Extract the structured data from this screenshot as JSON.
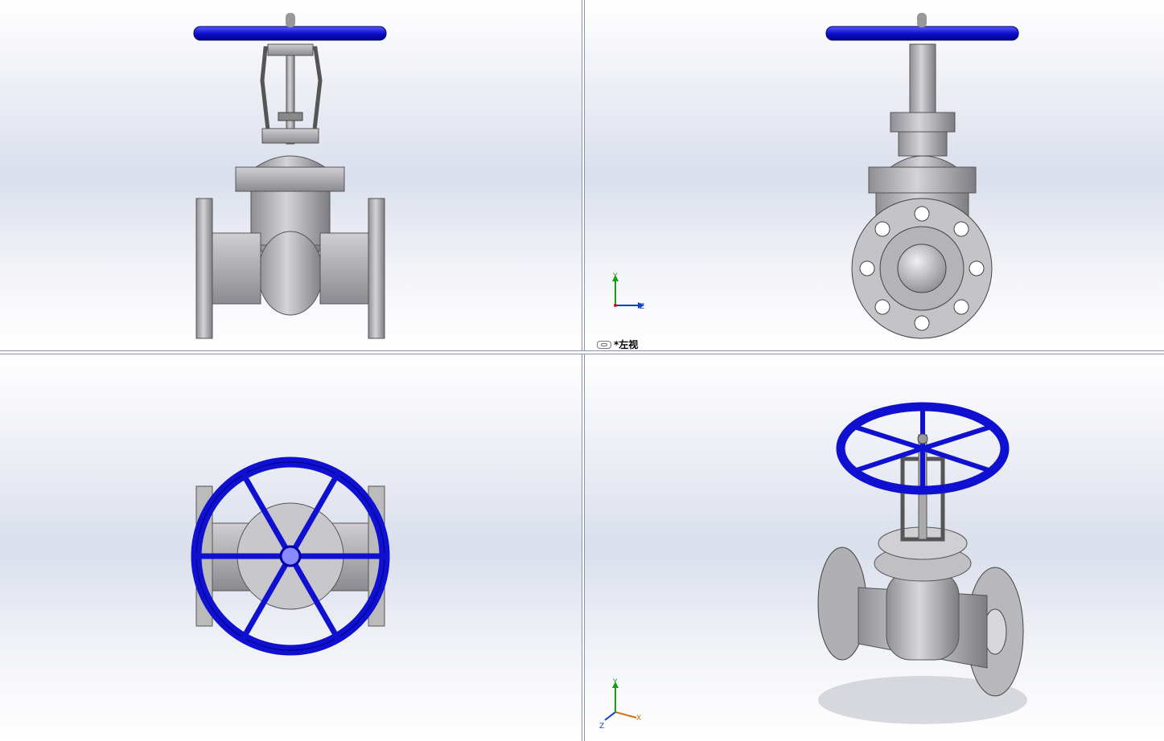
{
  "colors": {
    "handwheel": "#1a1adc",
    "metal": "#b8b8bc",
    "metal_dark": "#7a7a80",
    "axis_x": "#d01010",
    "axis_y": "#10a010",
    "axis_z": "#1040d0",
    "axis_x_iso": "#d07010"
  },
  "viewports": {
    "front": {
      "name": "front-view"
    },
    "left": {
      "name": "left-view",
      "label": "*左视"
    },
    "top": {
      "name": "top-view"
    },
    "iso": {
      "name": "isometric-view"
    }
  },
  "triads": {
    "left": {
      "y": "Y",
      "z": "Z"
    },
    "iso": {
      "y": "Y",
      "x": "X",
      "z": "Z"
    }
  }
}
